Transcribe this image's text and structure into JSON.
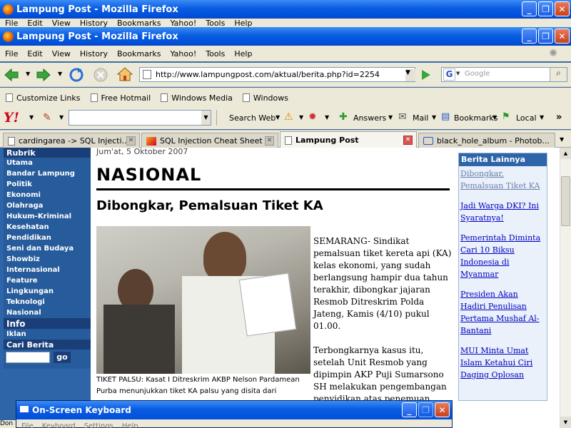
{
  "windows": {
    "back_title": "Lampung Post - Mozilla Firefox",
    "front_title": "Lampung Post - Mozilla Firefox",
    "title_buttons": [
      "_",
      "❐",
      "✕"
    ]
  },
  "menus": [
    "File",
    "Edit",
    "View",
    "History",
    "Bookmarks",
    "Yahoo!",
    "Tools",
    "Help"
  ],
  "navigation": {
    "url": "http://www.lampungpost.com/aktual/berita.php?id=2254",
    "search_placeholder": "Google"
  },
  "bookmarks": [
    "Customize Links",
    "Free Hotmail",
    "Windows Media",
    "Windows"
  ],
  "yahoo_toolbar": {
    "logo": "Y!",
    "search_web": "Search Web",
    "answers": "Answers",
    "mail": "Mail",
    "bookmarks": "Bookmarks",
    "local": "Local",
    "more": "»"
  },
  "tabs": [
    {
      "label": "cardingarea -> SQL Injecti...",
      "active": false
    },
    {
      "label": "SQL Injection Cheat Sheet",
      "active": false
    },
    {
      "label": "Lampung Post",
      "active": true
    },
    {
      "label": "black_hole_album - Photob...",
      "active": false
    }
  ],
  "left_nav": {
    "rubrik_header": "Rubrik",
    "items": [
      "Utama",
      "Bandar Lampung",
      "Politik",
      "Ekonomi",
      "Olahraga",
      "Hukum-Kriminal",
      "Kesehatan",
      "Pendidikan",
      "Seni dan Budaya",
      "Showbiz",
      "Internasional",
      "Feature",
      "Lingkungan",
      "Teknologi",
      "Nasional"
    ],
    "info_header": "Info",
    "info_items": [
      "Iklan"
    ],
    "search_header": "Cari Berita",
    "go_label": "go"
  },
  "article": {
    "date": "Jum'at, 5 Oktober 2007",
    "section": "NASIONAL",
    "headline": "Dibongkar, Pemalsuan Tiket KA",
    "caption": "TIKET PALSU: Kasat I Ditreskrim AKBP Nelson Pardamean Purba menunjukkan tiket KA palsu yang disita dari",
    "para1": "SEMARANG- Sindikat pemalsuan tiket kereta api (KA) kelas ekonomi, yang sudah berlangsung hampir dua tahun terakhir, dibongkar jajaran Resmob Ditreskrim Polda Jateng, Kamis (4/10) pukul 01.00.",
    "para2": "Terbongkarnya kasus itu, setelah Unit Resmob yang dipimpin AKP Puji Sumarsono SH melakukan pengembangan penyidikan atas penemuan indikasi dugaan pemalsuan tiket pada KA"
  },
  "sidebar": {
    "header": "Berita Lainnya",
    "links": [
      "Dibongkar, Pemalsuan Tiket KA",
      "Jadi Warga DKI? Ini Syaratnya!",
      "Pemerintah Diminta Cari 10 Biksu Indonesia di Myanmar",
      "Presiden Akan Hadiri Penulisan Pertama Mushaf Al-Bantani",
      "MUI Minta Umat Islam Ketahui Ciri Daging Oplosan"
    ]
  },
  "osk": {
    "title": "On-Screen Keyboard",
    "menus": [
      "File",
      "Keyboard",
      "Settings",
      "Help"
    ]
  },
  "status_text": "Don"
}
